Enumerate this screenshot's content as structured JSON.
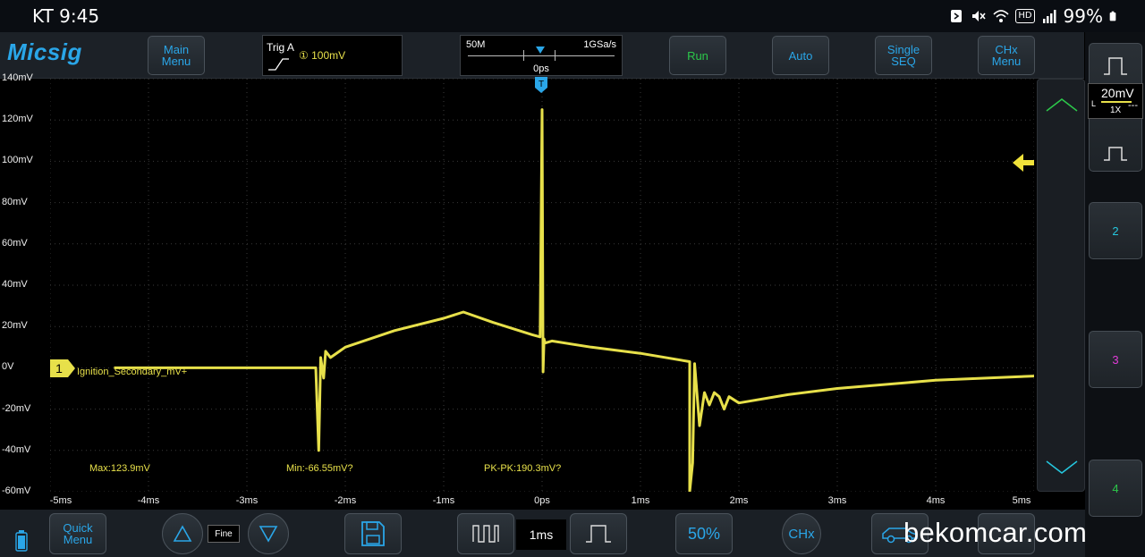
{
  "status_bar": {
    "carrier_time": "KT 9:45",
    "hd_badge": "HD",
    "battery": "99%"
  },
  "brand": {
    "logo": "Micsig"
  },
  "toolbar": {
    "main_menu": [
      "Main",
      "Menu"
    ],
    "trigger": {
      "label": "Trig  A",
      "level": "① 100mV"
    },
    "timebase": {
      "memory_depth": "50M",
      "sample_rate": "1GSa/s",
      "position": "0ps"
    },
    "run": "Run",
    "auto": "Auto",
    "single_seq": [
      "Single",
      "SEQ"
    ],
    "chx_menu": [
      "CHx",
      "Menu"
    ]
  },
  "channel": {
    "number": "1",
    "label": "Ignition_Secondary_mV+",
    "volts_per_div": "20mV",
    "probe": "1X",
    "coupling": "L",
    "color": "#e7e04a"
  },
  "side_channels": [
    "2",
    "3",
    "4"
  ],
  "side_channel_colors": [
    "#25c7de",
    "#e23bd8",
    "#2cc84a"
  ],
  "measurements": {
    "max": "Max:123.9mV",
    "min": "Min:-66.55mV?",
    "pk_pk": "PK-PK:190.3mV?"
  },
  "bottom_bar": {
    "quick_menu": [
      "Quick",
      "Menu"
    ],
    "fine": "Fine",
    "timebase_value": "1ms",
    "fifty_percent": "50%",
    "chx": "CHx"
  },
  "watermark": "bekomcar.com",
  "chart_data": {
    "type": "line",
    "title": "",
    "xlabel": "",
    "ylabel": "",
    "xlim": [
      -5,
      5
    ],
    "ylim": [
      -60,
      140
    ],
    "x_ticks": [
      "-5ms",
      "-4ms",
      "-3ms",
      "-2ms",
      "-1ms",
      "0ps",
      "1ms",
      "2ms",
      "3ms",
      "4ms",
      "5ms"
    ],
    "y_ticks": [
      "140mV",
      "120mV",
      "100mV",
      "80mV",
      "60mV",
      "40mV",
      "20mV",
      "0V",
      "-20mV",
      "-40mV",
      "-60mV"
    ],
    "grid": true,
    "series": [
      {
        "x": [
          -4.35,
          -3.0,
          -2.3,
          -2.27,
          -2.25,
          -2.22,
          -2.2,
          -2.15,
          -2.0,
          -1.5,
          -1.0,
          -0.8,
          -0.5,
          -0.1,
          -0.02,
          0.0,
          0.01,
          0.02,
          0.03,
          0.1,
          0.5,
          1.0,
          1.5,
          1.5,
          1.53,
          1.55,
          1.6,
          1.65,
          1.7,
          1.75,
          1.8,
          1.85,
          1.9,
          2.0,
          2.5,
          3.0,
          4.0,
          5.0
        ],
        "y": [
          0,
          0,
          0,
          -40,
          5,
          -5,
          8,
          5,
          10,
          18,
          24,
          27,
          22,
          16,
          15,
          125,
          -2,
          14,
          12,
          13,
          10,
          7,
          3,
          -60,
          -46,
          2,
          -28,
          -12,
          -18,
          -12,
          -14,
          -20,
          -14,
          -17,
          -13,
          -10,
          -6,
          -4
        ]
      }
    ]
  }
}
